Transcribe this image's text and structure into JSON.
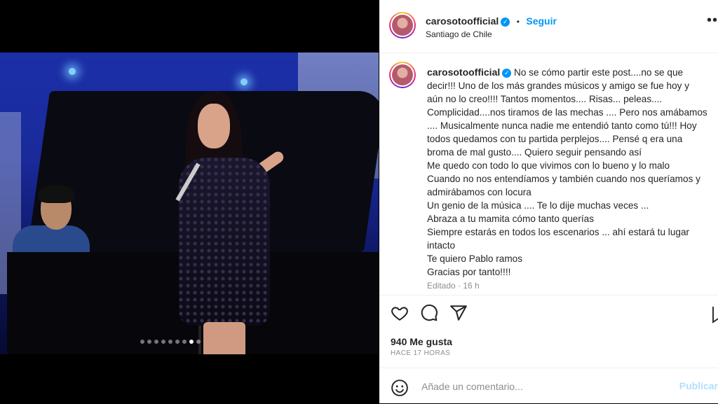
{
  "post": {
    "image_alt": "",
    "carousel": {
      "total": 9,
      "active": 8
    }
  },
  "header": {
    "username": "carosotoofficial",
    "separator": "•",
    "follow_label": "Seguir",
    "location": "Santiago de Chile"
  },
  "caption": {
    "username": "carosotoofficial",
    "lines": [
      "No se cómo partir este post....no se que",
      "decir!!! Uno de los más grandes músicos y amigo se fue hoy y",
      "aún no lo creo!!!! Tantos momentos.... Risas... peleas....",
      "Complicidad....nos tiramos de las mechas .... Pero nos amábamos",
      ".... Musicalmente nunca nadie me entendió tanto como tú!!! Hoy",
      "todos quedamos con tu partida perplejos.... Pensé q era una",
      "broma de mal gusto.... Quiero seguir pensando así",
      "Me quedo con todo lo que vivimos con lo bueno y lo malo",
      "Cuando no nos entendíamos y también cuando nos queríamos y",
      "admirábamos con locura",
      "Un genio de la música .... Te lo dije muchas veces ...",
      "Abraza a tu mamita cómo tanto querías",
      "Siempre estarás en todos los escenarios ... ahí estará tu lugar",
      "intacto",
      "Te quiero Pablo ramos",
      "Gracias por tanto!!!!"
    ],
    "edited": "Editado · 16 h"
  },
  "engagement": {
    "likes": "940 Me gusta",
    "time_ago": "HACE 17 HORAS"
  },
  "comment": {
    "placeholder": "Añade un comentario...",
    "post_label": "Publicar"
  },
  "icons": {
    "like": "heart-icon",
    "comment": "comment-icon",
    "share": "share-icon",
    "save": "bookmark-icon",
    "emoji": "emoji-icon",
    "verified": "verified-badge-icon",
    "more": "more-icon"
  },
  "colors": {
    "accent": "#0095f6",
    "muted": "#8e8e8e",
    "text": "#262626"
  }
}
